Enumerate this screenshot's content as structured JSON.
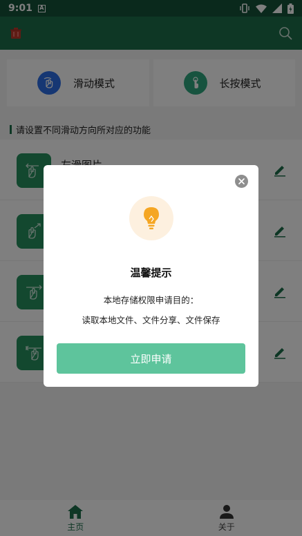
{
  "status_bar": {
    "time": "9:01",
    "notification_badge": "A"
  },
  "modes": [
    {
      "label": "滑动模式",
      "icon": "swipe-hand-icon"
    },
    {
      "label": "长按模式",
      "icon": "press-hand-icon"
    }
  ],
  "section_title": "请设置不同滑动方向所对应的功能",
  "functions": [
    {
      "name": "左滑图片",
      "icon": "swipe-left-icon"
    },
    {
      "name": "",
      "icon": "swipe-up-right-icon"
    },
    {
      "name": "",
      "icon": "swipe-right-icon"
    },
    {
      "name": "",
      "icon": "swipe-left-double-icon"
    }
  ],
  "bottom_nav": {
    "home_label": "主页",
    "about_label": "关于"
  },
  "dialog": {
    "title": "温馨提示",
    "message_line1": "本地存储权限申请目的：",
    "message_line2": "读取本地文件、文件分享、文件保存",
    "action_label": "立即申请"
  },
  "colors": {
    "primary": "#1d6e4b",
    "status_bar": "#155238",
    "action_button": "#5ec49c",
    "bulb": "#f5a623"
  }
}
